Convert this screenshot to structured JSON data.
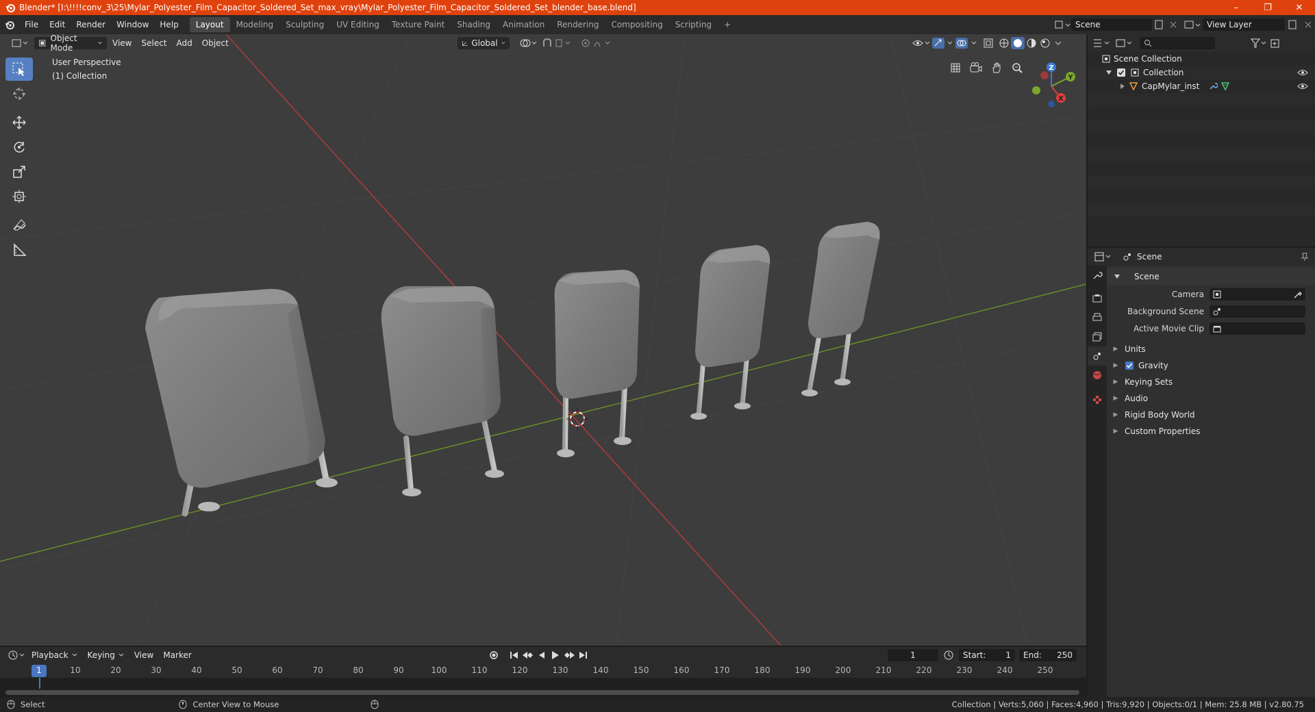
{
  "window": {
    "title": "Blender* [I:\\!!!!conv_3\\25\\Mylar_Polyester_Film_Capacitor_Soldered_Set_max_vray\\Mylar_Polyester_Film_Capacitor_Soldered_Set_blender_base.blend]",
    "controls": [
      "minimize",
      "maximize",
      "close"
    ]
  },
  "menu": [
    "File",
    "Edit",
    "Render",
    "Window",
    "Help"
  ],
  "workspaces": {
    "tabs": [
      "Layout",
      "Modeling",
      "Sculpting",
      "UV Editing",
      "Texture Paint",
      "Shading",
      "Animation",
      "Rendering",
      "Compositing",
      "Scripting"
    ],
    "active": "Layout",
    "add": "+"
  },
  "scene_selector": {
    "value": "Scene"
  },
  "view_layer_selector": {
    "value": "View Layer"
  },
  "viewport": {
    "mode": "Object Mode",
    "menus": [
      "View",
      "Select",
      "Add",
      "Object"
    ],
    "orientation": "Global",
    "overlay_line1": "User Perspective",
    "overlay_line2": "(1) Collection",
    "gizmo": {
      "x": "X",
      "y": "Y",
      "z": "Z"
    }
  },
  "toolbar": [
    "select-box",
    "cursor",
    "move",
    "rotate",
    "scale",
    "transform",
    "annotate",
    "measure"
  ],
  "outliner": {
    "root": "Scene Collection",
    "collection": "Collection",
    "object": "CapMylar_inst"
  },
  "properties": {
    "header": "Scene",
    "panel_title": "Scene",
    "camera_label": "Camera",
    "background_scene_label": "Background Scene",
    "active_movie_clip_label": "Active Movie Clip",
    "subpanels": [
      "Units",
      "Gravity",
      "Keying Sets",
      "Audio",
      "Rigid Body World",
      "Custom Properties"
    ],
    "gravity_checked": true
  },
  "timeline": {
    "menus": [
      "Playback",
      "Keying",
      "View",
      "Marker"
    ],
    "current_frame": "1",
    "start_label": "Start:",
    "start": "1",
    "end_label": "End:",
    "end": "250",
    "ruler_marks": [
      "1",
      "10",
      "20",
      "30",
      "40",
      "50",
      "60",
      "70",
      "80",
      "90",
      "100",
      "110",
      "120",
      "130",
      "140",
      "150",
      "160",
      "170",
      "180",
      "190",
      "200",
      "210",
      "220",
      "230",
      "240",
      "250"
    ]
  },
  "statusbar": {
    "left_action": "Select",
    "middle_action": "Center View to Mouse",
    "stats": "Collection | Verts:5,060 | Faces:4,960 | Tris:9,920 | Objects:0/1 | Mem: 25.8 MB | v2.80.75"
  },
  "colors": {
    "titlebar": "#e0420d",
    "viewport_bg": "#3d3d3d",
    "active_tool": "#5680c2",
    "x_axis": "#d93f3f",
    "y_axis": "#7ba82c",
    "z_axis": "#3b79d6"
  }
}
